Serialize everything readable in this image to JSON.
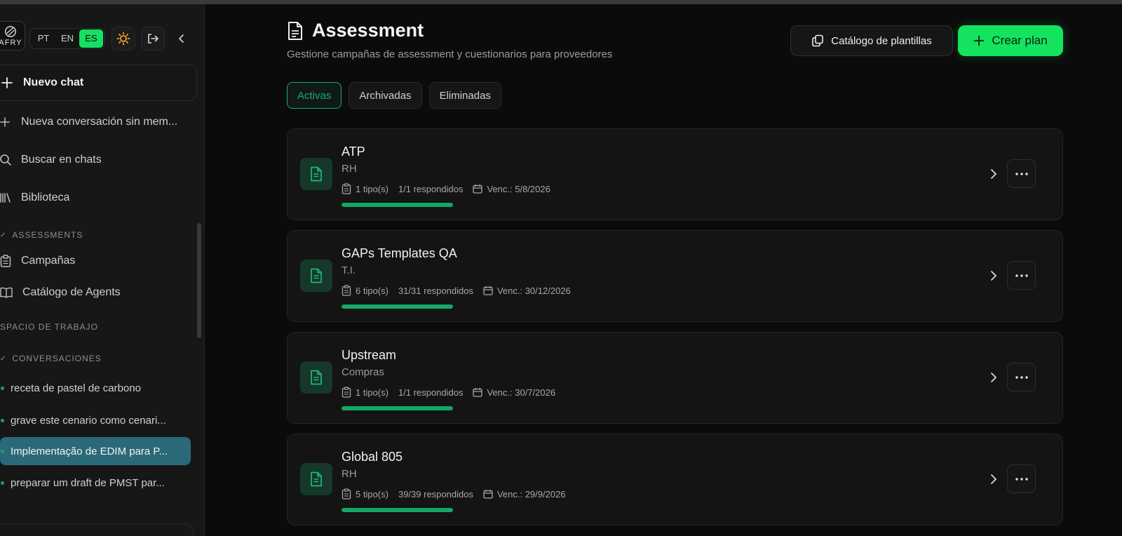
{
  "sidebar": {
    "logo_text": "AFRY",
    "languages": [
      "PT",
      "EN",
      "ES"
    ],
    "active_language": "ES",
    "new_chat": "Nuevo chat",
    "nav": [
      {
        "icon": "plus-icon",
        "label": "Nueva conversación sin mem..."
      },
      {
        "icon": "search-icon",
        "label": "Buscar en chats"
      },
      {
        "icon": "library-icon",
        "label": "Biblioteca"
      }
    ],
    "assessments_header": "ASSESSMENTS",
    "assessments_items": [
      {
        "icon": "clipboard-icon",
        "label": "Campañas"
      },
      {
        "icon": "book-icon",
        "label": "Catálogo de Agents"
      }
    ],
    "workspace_header": "SPACIO DE TRABAJO",
    "conversations_header": "CONVERSACIONES",
    "conversations": [
      {
        "label": "receta de pastel de carbono",
        "active": false
      },
      {
        "label": "grave este cenario como cenari...",
        "active": false
      },
      {
        "label": "Implementação de EDIM para P...",
        "active": true
      },
      {
        "label": "preparar um draft de PMST par...",
        "active": false
      }
    ]
  },
  "header": {
    "title": "Assessment",
    "subtitle": "Gestione campañas de assessment y cuestionarios para proveedores",
    "catalog_button": "Catálogo de plantillas",
    "create_button": "Crear plan"
  },
  "tabs": [
    {
      "label": "Activas",
      "active": true
    },
    {
      "label": "Archivadas",
      "active": false
    },
    {
      "label": "Eliminadas",
      "active": false
    }
  ],
  "campaigns": [
    {
      "name": "ATP",
      "dept": "RH",
      "types": "1 tipo(s)",
      "responses": "1/1 respondidos",
      "due": "Venc.: 5/8/2026",
      "progress": 1.0
    },
    {
      "name": "GAPs Templates QA",
      "dept": "T.I.",
      "types": "6 tipo(s)",
      "responses": "31/31 respondidos",
      "due": "Venc.: 30/12/2026",
      "progress": 1.0
    },
    {
      "name": "Upstream",
      "dept": "Compras",
      "types": "1 tipo(s)",
      "responses": "1/1 respondidos",
      "due": "Venc.: 30/7/2026",
      "progress": 1.0
    },
    {
      "name": "Global 805",
      "dept": "RH",
      "types": "5 tipo(s)",
      "responses": "39/39 respondidos",
      "due": "Venc.: 29/9/2026",
      "progress": 1.0
    }
  ],
  "colors": {
    "accent": "#13e35e",
    "accent_dark": "#13a866",
    "active_conversation": "#2a6a78",
    "background": "#0b0b0b",
    "sidebar": "#171717",
    "sun": "#f5a623"
  }
}
